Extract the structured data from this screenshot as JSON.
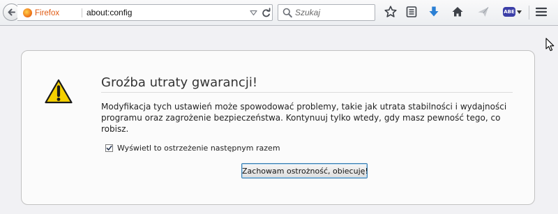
{
  "browser": {
    "identity_label": "Firefox",
    "url": "about:config",
    "search_placeholder": "Szukaj",
    "abe_badge": "ABE"
  },
  "warning": {
    "title": "Groźba utraty gwarancji!",
    "message": "Modyfikacja tych ustawień może spowodować problemy, takie jak utrata stabilności i wydajności programu oraz zagrożenie bezpieczeństwa. Kontynuuj tylko wtedy, gdy masz pewność tego, co robisz.",
    "checkbox_label": "Wyświetl to ostrzeżenie następnym razem",
    "checkbox_checked": true,
    "button_label": "Zachowam ostrożność, obiecuję!"
  },
  "colors": {
    "firefox_orange": "#e05a12",
    "download_blue": "#2a7fd4",
    "warning_yellow": "#f5d000",
    "abe_blue": "#3c3fa8"
  },
  "icons": {
    "toolbar": [
      "back-arrow-icon",
      "firefox-logo-icon",
      "url-dropdown-icon",
      "reload-icon",
      "search-icon",
      "bookmark-star-icon",
      "bookmarks-list-icon",
      "download-icon",
      "home-icon",
      "send-icon",
      "noscript-abe-icon",
      "menu-icon"
    ],
    "content": [
      "warning-triangle-icon"
    ]
  }
}
